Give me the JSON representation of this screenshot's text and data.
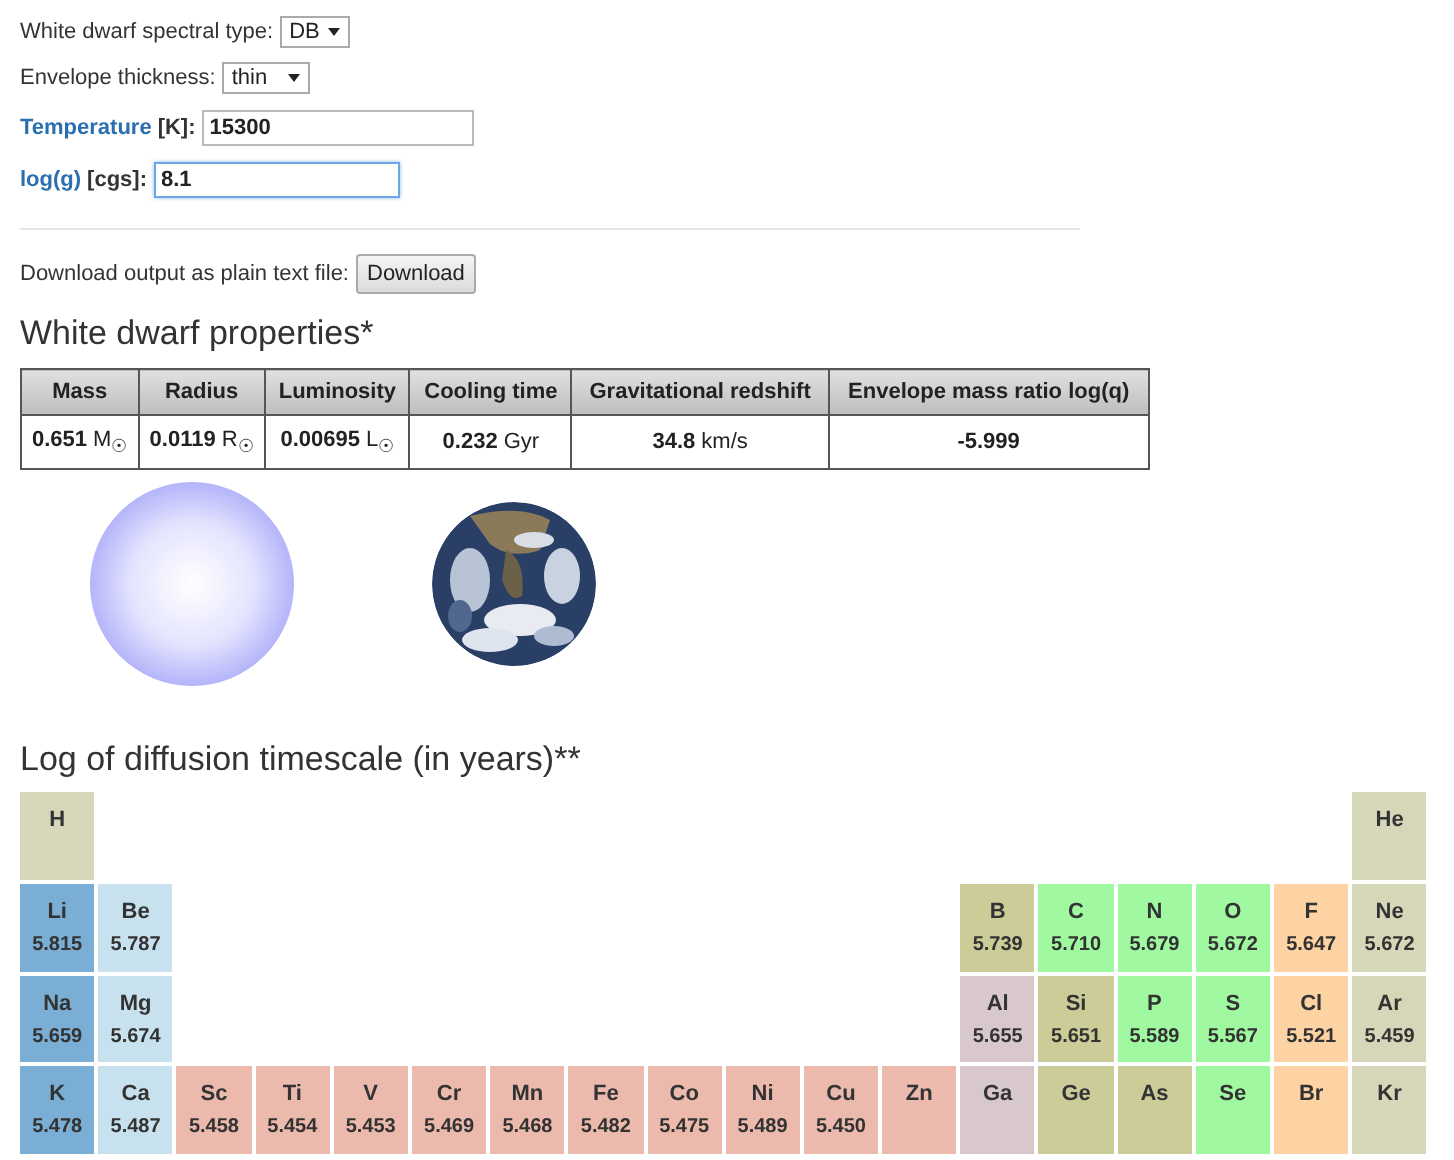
{
  "form": {
    "spectral_type": {
      "label": "White dwarf spectral type:",
      "value": "DB"
    },
    "envelope": {
      "label": "Envelope thickness:",
      "value": "thin"
    },
    "temperature": {
      "link": "Temperature",
      "unit": "[K]:",
      "value": "15300",
      "focused": false
    },
    "logg": {
      "link": "log(g)",
      "unit": "[cgs]:",
      "value": "8.1",
      "focused": true
    }
  },
  "download": {
    "label": "Download output as plain text file:",
    "button": "Download"
  },
  "properties": {
    "title": "White dwarf properties*",
    "columns": [
      "Mass",
      "Radius",
      "Luminosity",
      "Cooling time",
      "Gravitational redshift",
      "Envelope mass ratio log(q)"
    ],
    "values": [
      "**0.651** M$_{☉}$",
      "**0.0119** R$_{☉}$",
      "**0.00695** L$_{☉}$",
      "**0.232** Gyr",
      "**34.8** km/s",
      "**-5.999**"
    ]
  },
  "images": [
    {
      "kind": "star"
    },
    {
      "kind": "picture"
    }
  ],
  "diffusion": {
    "title": "Log of diffusion timescale (in years)**",
    "rows": [
      {
        "cells": [
          {
            "kind": "element",
            "symbol": "H",
            "color": "#d6d6b8"
          },
          "",
          "",
          "",
          "",
          "",
          "",
          "",
          "",
          "",
          "",
          "",
          "",
          "",
          "",
          "",
          "",
          {
            "kind": "element",
            "symbol": "He",
            "color": "#d6d6b8"
          }
        ]
      },
      {
        "cells": [
          {
            "kind": "element",
            "symbol": "Li",
            "value": "5.815",
            "color": "#7aaed4"
          },
          {
            "kind": "element",
            "symbol": "Be",
            "value": "5.787",
            "color": "#c8e1ee"
          },
          "",
          "",
          "",
          "",
          "",
          "",
          "",
          "",
          "",
          "",
          {
            "kind": "element",
            "symbol": "B",
            "value": "5.739",
            "color": "#cccc99"
          },
          {
            "kind": "element",
            "symbol": "C",
            "value": "5.710",
            "color": "#a0f9a0"
          },
          {
            "kind": "element",
            "symbol": "N",
            "value": "5.679",
            "color": "#a0f9a0"
          },
          {
            "kind": "element",
            "symbol": "O",
            "value": "5.672",
            "color": "#a0f9a0"
          },
          {
            "kind": "element",
            "symbol": "F",
            "value": "5.647",
            "color": "#fdd3a3"
          },
          {
            "kind": "element",
            "symbol": "Ne",
            "value": "5.672",
            "color": "#d6d6b8"
          }
        ]
      },
      {
        "cells": [
          {
            "kind": "element",
            "symbol": "Na",
            "value": "5.659",
            "color": "#7aaed4"
          },
          {
            "kind": "element",
            "symbol": "Mg",
            "value": "5.674",
            "color": "#c8e1ee"
          },
          "",
          "",
          "",
          "",
          "",
          "",
          "",
          "",
          "",
          "",
          {
            "kind": "element",
            "symbol": "Al",
            "value": "5.655",
            "color": "#d8c8cc"
          },
          {
            "kind": "element",
            "symbol": "Si",
            "value": "5.651",
            "color": "#cccc99"
          },
          {
            "kind": "element",
            "symbol": "P",
            "value": "5.589",
            "color": "#a0f9a0"
          },
          {
            "kind": "element",
            "symbol": "S",
            "value": "5.567",
            "color": "#a0f9a0"
          },
          {
            "kind": "element",
            "symbol": "Cl",
            "value": "5.521",
            "color": "#fdd3a3"
          },
          {
            "kind": "element",
            "symbol": "Ar",
            "value": "5.459",
            "color": "#d6d6b8"
          }
        ]
      },
      {
        "cells": [
          {
            "kind": "element",
            "symbol": "K",
            "value": "5.478",
            "color": "#7aaed4"
          },
          {
            "kind": "element",
            "symbol": "Ca",
            "value": "5.487",
            "color": "#c8e1ee"
          },
          {
            "kind": "element",
            "symbol": "Sc",
            "value": "5.458",
            "color": "#ebbaad"
          },
          {
            "kind": "element",
            "symbol": "Ti",
            "value": "5.454",
            "color": "#ebbaad"
          },
          {
            "kind": "element",
            "symbol": "V",
            "value": "5.453",
            "color": "#ebbaad"
          },
          {
            "kind": "element",
            "symbol": "Cr",
            "value": "5.469",
            "color": "#ebbaad"
          },
          {
            "kind": "element",
            "symbol": "Mn",
            "value": "5.468",
            "color": "#ebbaad"
          },
          {
            "kind": "element",
            "symbol": "Fe",
            "value": "5.482",
            "color": "#ebbaad"
          },
          {
            "kind": "element",
            "symbol": "Co",
            "value": "5.475",
            "color": "#ebbaad"
          },
          {
            "kind": "element",
            "symbol": "Ni",
            "value": "5.489",
            "color": "#ebbaad"
          },
          {
            "kind": "element",
            "symbol": "Cu",
            "value": "5.450",
            "color": "#ebbaad"
          },
          {
            "kind": "element",
            "symbol": "Zn",
            "color": "#ebbaad"
          },
          {
            "kind": "element",
            "symbol": "Ga",
            "color": "#d8c8cc"
          },
          {
            "kind": "element",
            "symbol": "Ge",
            "color": "#cccc99"
          },
          {
            "kind": "element",
            "symbol": "As",
            "color": "#cccc99"
          },
          {
            "kind": "element",
            "symbol": "Se",
            "color": "#a0f9a0"
          },
          {
            "kind": "element",
            "symbol": "Br",
            "color": "#fdd3a3"
          },
          {
            "kind": "element",
            "symbol": "Kr",
            "color": "#d6d6b8"
          }
        ]
      }
    ]
  }
}
